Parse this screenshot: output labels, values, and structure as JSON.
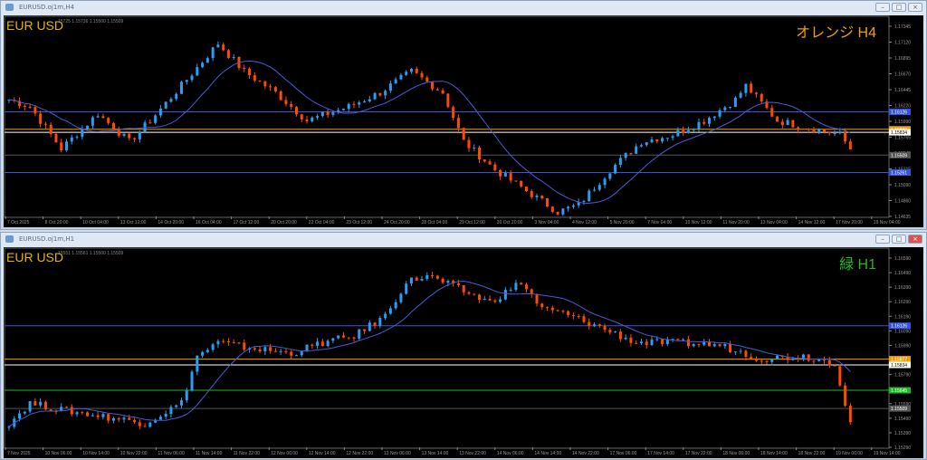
{
  "windows": [
    {
      "title": "EURUSD.oj1m,H4",
      "symbol_label": "EUR USD",
      "ohlc": "15725 1.15736 1.15500 1.15509",
      "overlay_label": "オレンジ H4",
      "overlay_color": "#f0a000",
      "price_range": [
        1.14635,
        1.17345
      ],
      "price_ticks": [
        "1.17345",
        "1.17120",
        "1.16895",
        "1.16670",
        "1.16445",
        "1.16220",
        "1.15990",
        "1.15765",
        "1.15540",
        "1.15315",
        "1.15090",
        "1.14860",
        "1.14635"
      ],
      "time_ticks": [
        "7 Oct 2025",
        "8 Oct 20:00",
        "10 Oct 04:00",
        "13 Oct 12:00",
        "14 Oct 20:00",
        "16 Oct 04:00",
        "17 Oct 12:00",
        "20 Oct 20:00",
        "22 Oct 04:00",
        "23 Oct 12:00",
        "24 Oct 20:00",
        "28 Oct 04:00",
        "29 Oct 12:00",
        "30 Oct 20:00",
        "3 Nov 04:00",
        "4 Nov 12:00",
        "5 Nov 20:00",
        "7 Nov 04:00",
        "10 Nov 12:00",
        "11 Nov 20:00",
        "13 Nov 04:00",
        "14 Nov 12:00",
        "17 Nov 20:00",
        "19 Nov 04:00"
      ],
      "levels": [
        {
          "price": "1.16126",
          "color": "#3355dd"
        },
        {
          "price": "1.15877",
          "color": "#f0a000"
        },
        {
          "price": "1.15834",
          "color": "#ffffff"
        },
        {
          "price": "1.15509",
          "color": "#555555"
        },
        {
          "price": "1.15261",
          "color": "#3355dd"
        }
      ],
      "path": [
        [
          0,
          1.163
        ],
        [
          4,
          1.162
        ],
        [
          10,
          1.156
        ],
        [
          17,
          1.161
        ],
        [
          23,
          1.157
        ],
        [
          27,
          1.16
        ],
        [
          33,
          1.165
        ],
        [
          40,
          1.171
        ],
        [
          45,
          1.167
        ],
        [
          51,
          1.164
        ],
        [
          57,
          1.16
        ],
        [
          65,
          1.162
        ],
        [
          71,
          1.164
        ],
        [
          77,
          1.167
        ],
        [
          83,
          1.164
        ],
        [
          87,
          1.157
        ],
        [
          93,
          1.153
        ],
        [
          99,
          1.15
        ],
        [
          105,
          1.147
        ],
        [
          109,
          1.148
        ],
        [
          115,
          1.153
        ],
        [
          121,
          1.157
        ],
        [
          127,
          1.158
        ],
        [
          133,
          1.16
        ],
        [
          139,
          1.163
        ],
        [
          141,
          1.165
        ],
        [
          147,
          1.16
        ],
        [
          153,
          1.159
        ],
        [
          159,
          1.158
        ],
        [
          161,
          1.156
        ]
      ]
    },
    {
      "title": "EURUSD.oj1m,H1",
      "symbol_label": "EUR USD",
      "ohlc": "15551 1.15561 1.15500 1.15509",
      "overlay_label": "緑 H1",
      "overlay_color": "#22bb22",
      "price_range": [
        1.1522,
        1.1663
      ],
      "price_ticks": [
        "1.16590",
        "1.16490",
        "1.16390",
        "1.16290",
        "1.16190",
        "1.16090",
        "1.15990",
        "1.15890",
        "1.15790",
        "1.15690",
        "1.15590",
        "1.15490",
        "1.15390",
        "1.15290"
      ],
      "time_ticks": [
        "7 Nov 2025",
        "10 Nov 06:00",
        "10 Nov 14:00",
        "10 Nov 22:00",
        "11 Nov 06:00",
        "11 Nov 14:00",
        "11 Nov 22:00",
        "12 Nov 06:00",
        "12 Nov 14:00",
        "12 Nov 22:00",
        "13 Nov 06:00",
        "13 Nov 14:00",
        "13 Nov 22:00",
        "14 Nov 06:00",
        "14 Nov 14:00",
        "14 Nov 22:00",
        "17 Nov 06:00",
        "17 Nov 14:00",
        "17 Nov 22:00",
        "18 Nov 06:00",
        "18 Nov 14:00",
        "18 Nov 22:00",
        "19 Nov 06:00",
        "19 Nov 14:00"
      ],
      "levels": [
        {
          "price": "1.16126",
          "color": "#3355dd"
        },
        {
          "price": "1.15877",
          "color": "#f0a000"
        },
        {
          "price": "1.15834",
          "color": "#ffffff"
        },
        {
          "price": "1.15645",
          "color": "#22bb22"
        },
        {
          "price": "1.15509",
          "color": "#555555"
        }
      ],
      "path": [
        [
          0,
          1.154
        ],
        [
          4,
          1.1555
        ],
        [
          10,
          1.155
        ],
        [
          18,
          1.1545
        ],
        [
          26,
          1.154
        ],
        [
          33,
          1.1555
        ],
        [
          36,
          1.159
        ],
        [
          40,
          1.16
        ],
        [
          48,
          1.1595
        ],
        [
          54,
          1.1592
        ],
        [
          60,
          1.16
        ],
        [
          66,
          1.1605
        ],
        [
          72,
          1.162
        ],
        [
          76,
          1.1645
        ],
        [
          80,
          1.165
        ],
        [
          86,
          1.164
        ],
        [
          92,
          1.163
        ],
        [
          98,
          1.1645
        ],
        [
          102,
          1.1625
        ],
        [
          106,
          1.1622
        ],
        [
          114,
          1.161
        ],
        [
          120,
          1.16
        ],
        [
          128,
          1.16
        ],
        [
          136,
          1.1598
        ],
        [
          144,
          1.1588
        ],
        [
          152,
          1.159
        ],
        [
          158,
          1.1585
        ],
        [
          161,
          1.154
        ]
      ]
    }
  ],
  "colors": {
    "bull": "#2a9df4",
    "bear": "#ff4a00",
    "ma": "#4a5bd8",
    "grid": "#333333",
    "axis_text": "#999999"
  }
}
